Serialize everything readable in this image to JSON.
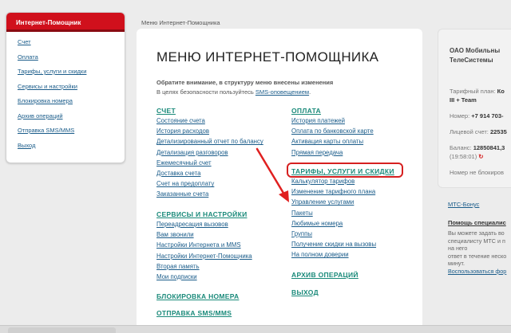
{
  "sidebar": {
    "title": "Интернет-Помощник",
    "items": [
      "Счет",
      "Оплата",
      "Тарифы, услуги и скидки",
      "Сервисы и настройки",
      "Блокировка номера",
      "Архив операций",
      "Отправка SMS/MMS",
      "Выход"
    ]
  },
  "breadcrumb": "Меню Интернет-Помощника",
  "main": {
    "title": "МЕНЮ ИНТЕРНЕТ-ПОМОЩНИКА",
    "notice_bold": "Обратите внимание, в структуру меню внесены изменения",
    "notice_prefix": "В целях безопасности пользуйтесь ",
    "notice_link": "SMS-оповещением",
    "notice_suffix": ".",
    "schet": {
      "head": "СЧЕТ",
      "items": [
        "Состояние счета",
        "История расходов",
        "Детализированный отчет по балансу",
        "Детализация разговоров",
        "Ежемесячный счет",
        "Доставка счета",
        "Счет на предоплату",
        "Заказанные счета"
      ]
    },
    "servisy": {
      "head": "СЕРВИСЫ И НАСТРОЙКИ",
      "items": [
        "Переадресация вызовов",
        "Вам звонили",
        "Настройки Интернета и MMS",
        "Настройки Интернет-Помощника",
        "Вторая память",
        "Мои подписки"
      ]
    },
    "blokirovka_head": "БЛОКИРОВКА НОМЕРА",
    "otpravka_head": "ОТПРАВКА SMS/MMS",
    "oplata": {
      "head": "ОПЛАТА",
      "items": [
        "История платежей",
        "Оплата по банковской карте",
        "Активация карты оплаты",
        "Прямая передача"
      ]
    },
    "tarify": {
      "head": "ТАРИФЫ, УСЛУГИ И СКИДКИ",
      "items": [
        "Калькулятор тарифов",
        "Изменение тарифного плана",
        "Управление услугами",
        "Пакеты",
        "Любимые номера",
        "Группы",
        "Получение скидки на вызовы",
        "На полном доверии"
      ]
    },
    "arhiv_head": "АРХИВ ОПЕРАЦИЙ",
    "vyhod_head": "ВЫХОД"
  },
  "right": {
    "company_line1": "ОАО Мобильны",
    "company_line2": "ТелеСистемы",
    "tariff_label": "Тарифный план: ",
    "tariff_value": "Ко",
    "tariff_line2": "III + Team",
    "phone_label": "Номер: ",
    "phone_value": "+7 914 703-",
    "account_label": "Лицевой счет: ",
    "account_value": "22535",
    "balance_label": "Баланс: ",
    "balance_value": "12850841,3",
    "balance_time": "(19:58:01)",
    "block_status": "Номер не блокиров",
    "mts_bonus": "МТС-Бонус",
    "help_title": "Помощь специалис",
    "help_lines": [
      "Вы можете задать во",
      "специалисту МТС и п",
      "на него",
      "ответ в течение неско",
      "минут."
    ],
    "help_link": "Воспользоваться фор"
  },
  "colors": {
    "accent_red": "#d0101c",
    "link_blue": "#1a5c8a",
    "section_teal": "#1a8a7a"
  }
}
